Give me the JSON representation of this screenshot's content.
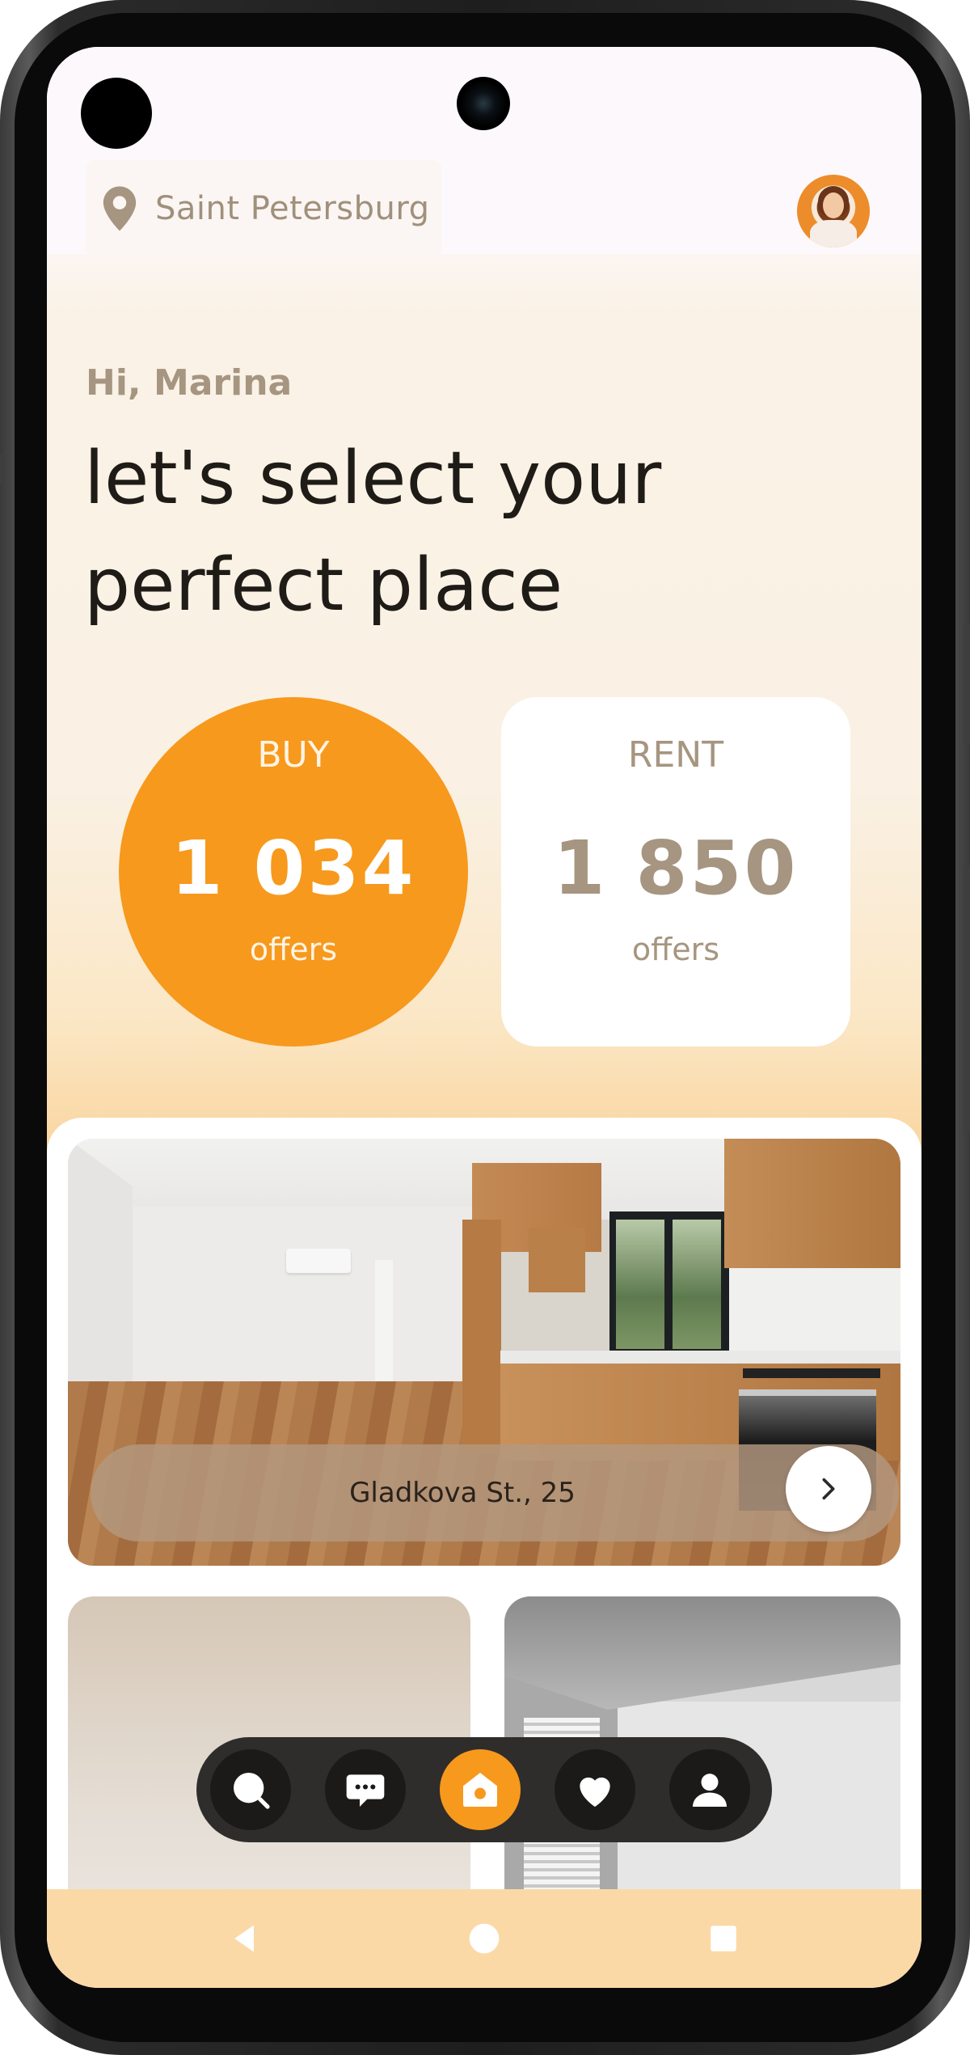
{
  "header": {
    "location": "Saint Petersburg",
    "location_icon": "map-pin-icon",
    "avatar_icon": "user-avatar"
  },
  "hero": {
    "greeting": "Hi, Marina",
    "headline_line1": "let's select your",
    "headline_line2": "perfect place"
  },
  "offers": {
    "buy": {
      "label": "BUY",
      "count": "1 034",
      "unit": "offers"
    },
    "rent": {
      "label": "RENT",
      "count": "1 850",
      "unit": "offers"
    }
  },
  "listings": {
    "featured": {
      "address": "Gladkova St., 25",
      "action_icon": "chevron-right-icon"
    }
  },
  "bottom_nav": {
    "items": [
      {
        "icon": "search-icon",
        "active": false
      },
      {
        "icon": "chat-icon",
        "active": false
      },
      {
        "icon": "home-icon",
        "active": true
      },
      {
        "icon": "heart-icon",
        "active": false
      },
      {
        "icon": "profile-icon",
        "active": false
      }
    ]
  },
  "system_nav": {
    "items": [
      "back-icon",
      "home-circle-icon",
      "recents-icon"
    ]
  },
  "colors": {
    "accent": "#f7991c",
    "muted": "#a69580",
    "nav_bg": "#2f2d2b"
  }
}
